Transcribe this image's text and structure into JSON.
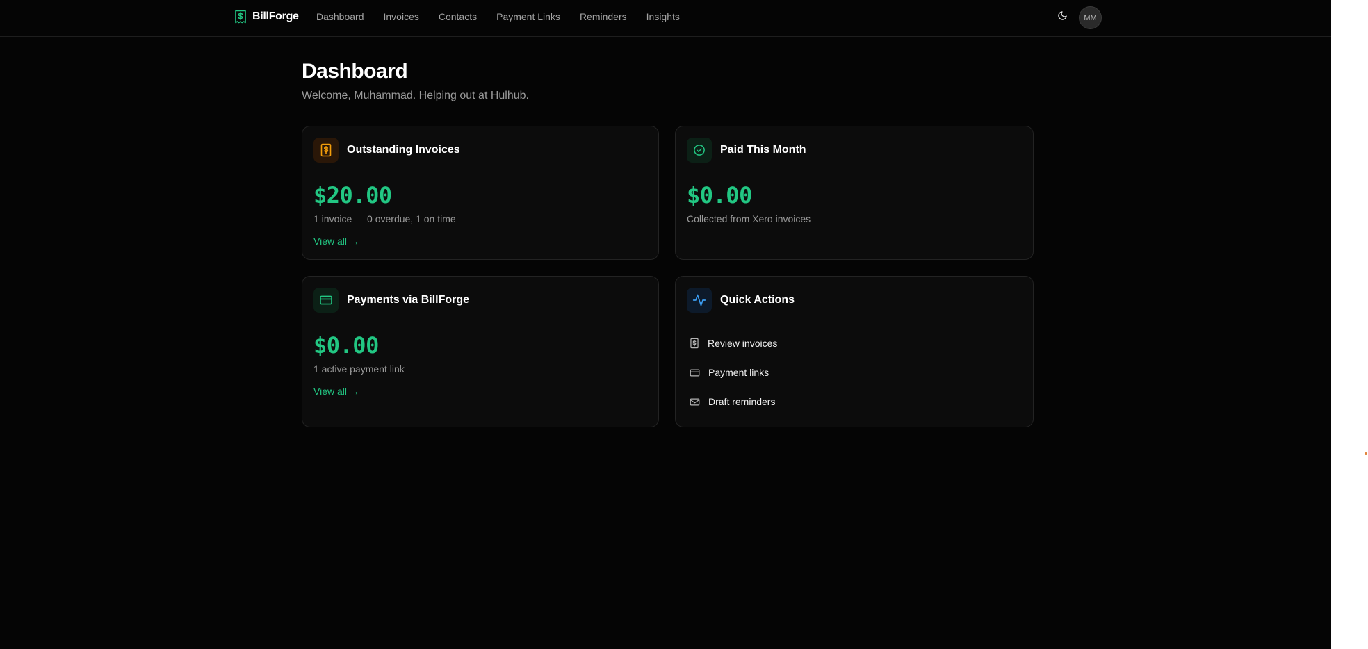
{
  "brand": {
    "name": "BillForge",
    "icon": "invoice-dollar-icon",
    "accent": "#22c783"
  },
  "nav": {
    "links": [
      {
        "label": "Dashboard"
      },
      {
        "label": "Invoices"
      },
      {
        "label": "Contacts"
      },
      {
        "label": "Payment Links"
      },
      {
        "label": "Reminders"
      },
      {
        "label": "Insights"
      }
    ],
    "theme_icon": "moon-icon",
    "avatar_initials": "MM"
  },
  "page": {
    "title": "Dashboard",
    "subtitle": "Welcome, Muhammad. Helping out at Hulhub."
  },
  "cards": {
    "outstanding": {
      "icon": "invoice-dollar-icon",
      "icon_color": "#f59e0b",
      "title": "Outstanding Invoices",
      "amount": "$20.00",
      "description": "1 invoice — 0 overdue, 1 on time",
      "link": "View all →"
    },
    "paid": {
      "icon": "check-circle-icon",
      "icon_color": "#22c783",
      "title": "Paid This Month",
      "amount": "$0.00",
      "description": "Collected from Xero invoices"
    },
    "payments": {
      "icon": "credit-card-icon",
      "icon_color": "#22c783",
      "title": "Payments via BillForge",
      "amount": "$0.00",
      "description": "1 active payment link",
      "link": "View all →"
    },
    "quick_actions": {
      "icon": "activity-icon",
      "icon_color": "#3b9cf0",
      "title": "Quick Actions",
      "items": [
        {
          "label": "Review invoices",
          "icon": "invoice-dollar-icon"
        },
        {
          "label": "Payment links",
          "icon": "credit-card-icon"
        },
        {
          "label": "Draft reminders",
          "icon": "mail-icon"
        }
      ]
    }
  }
}
